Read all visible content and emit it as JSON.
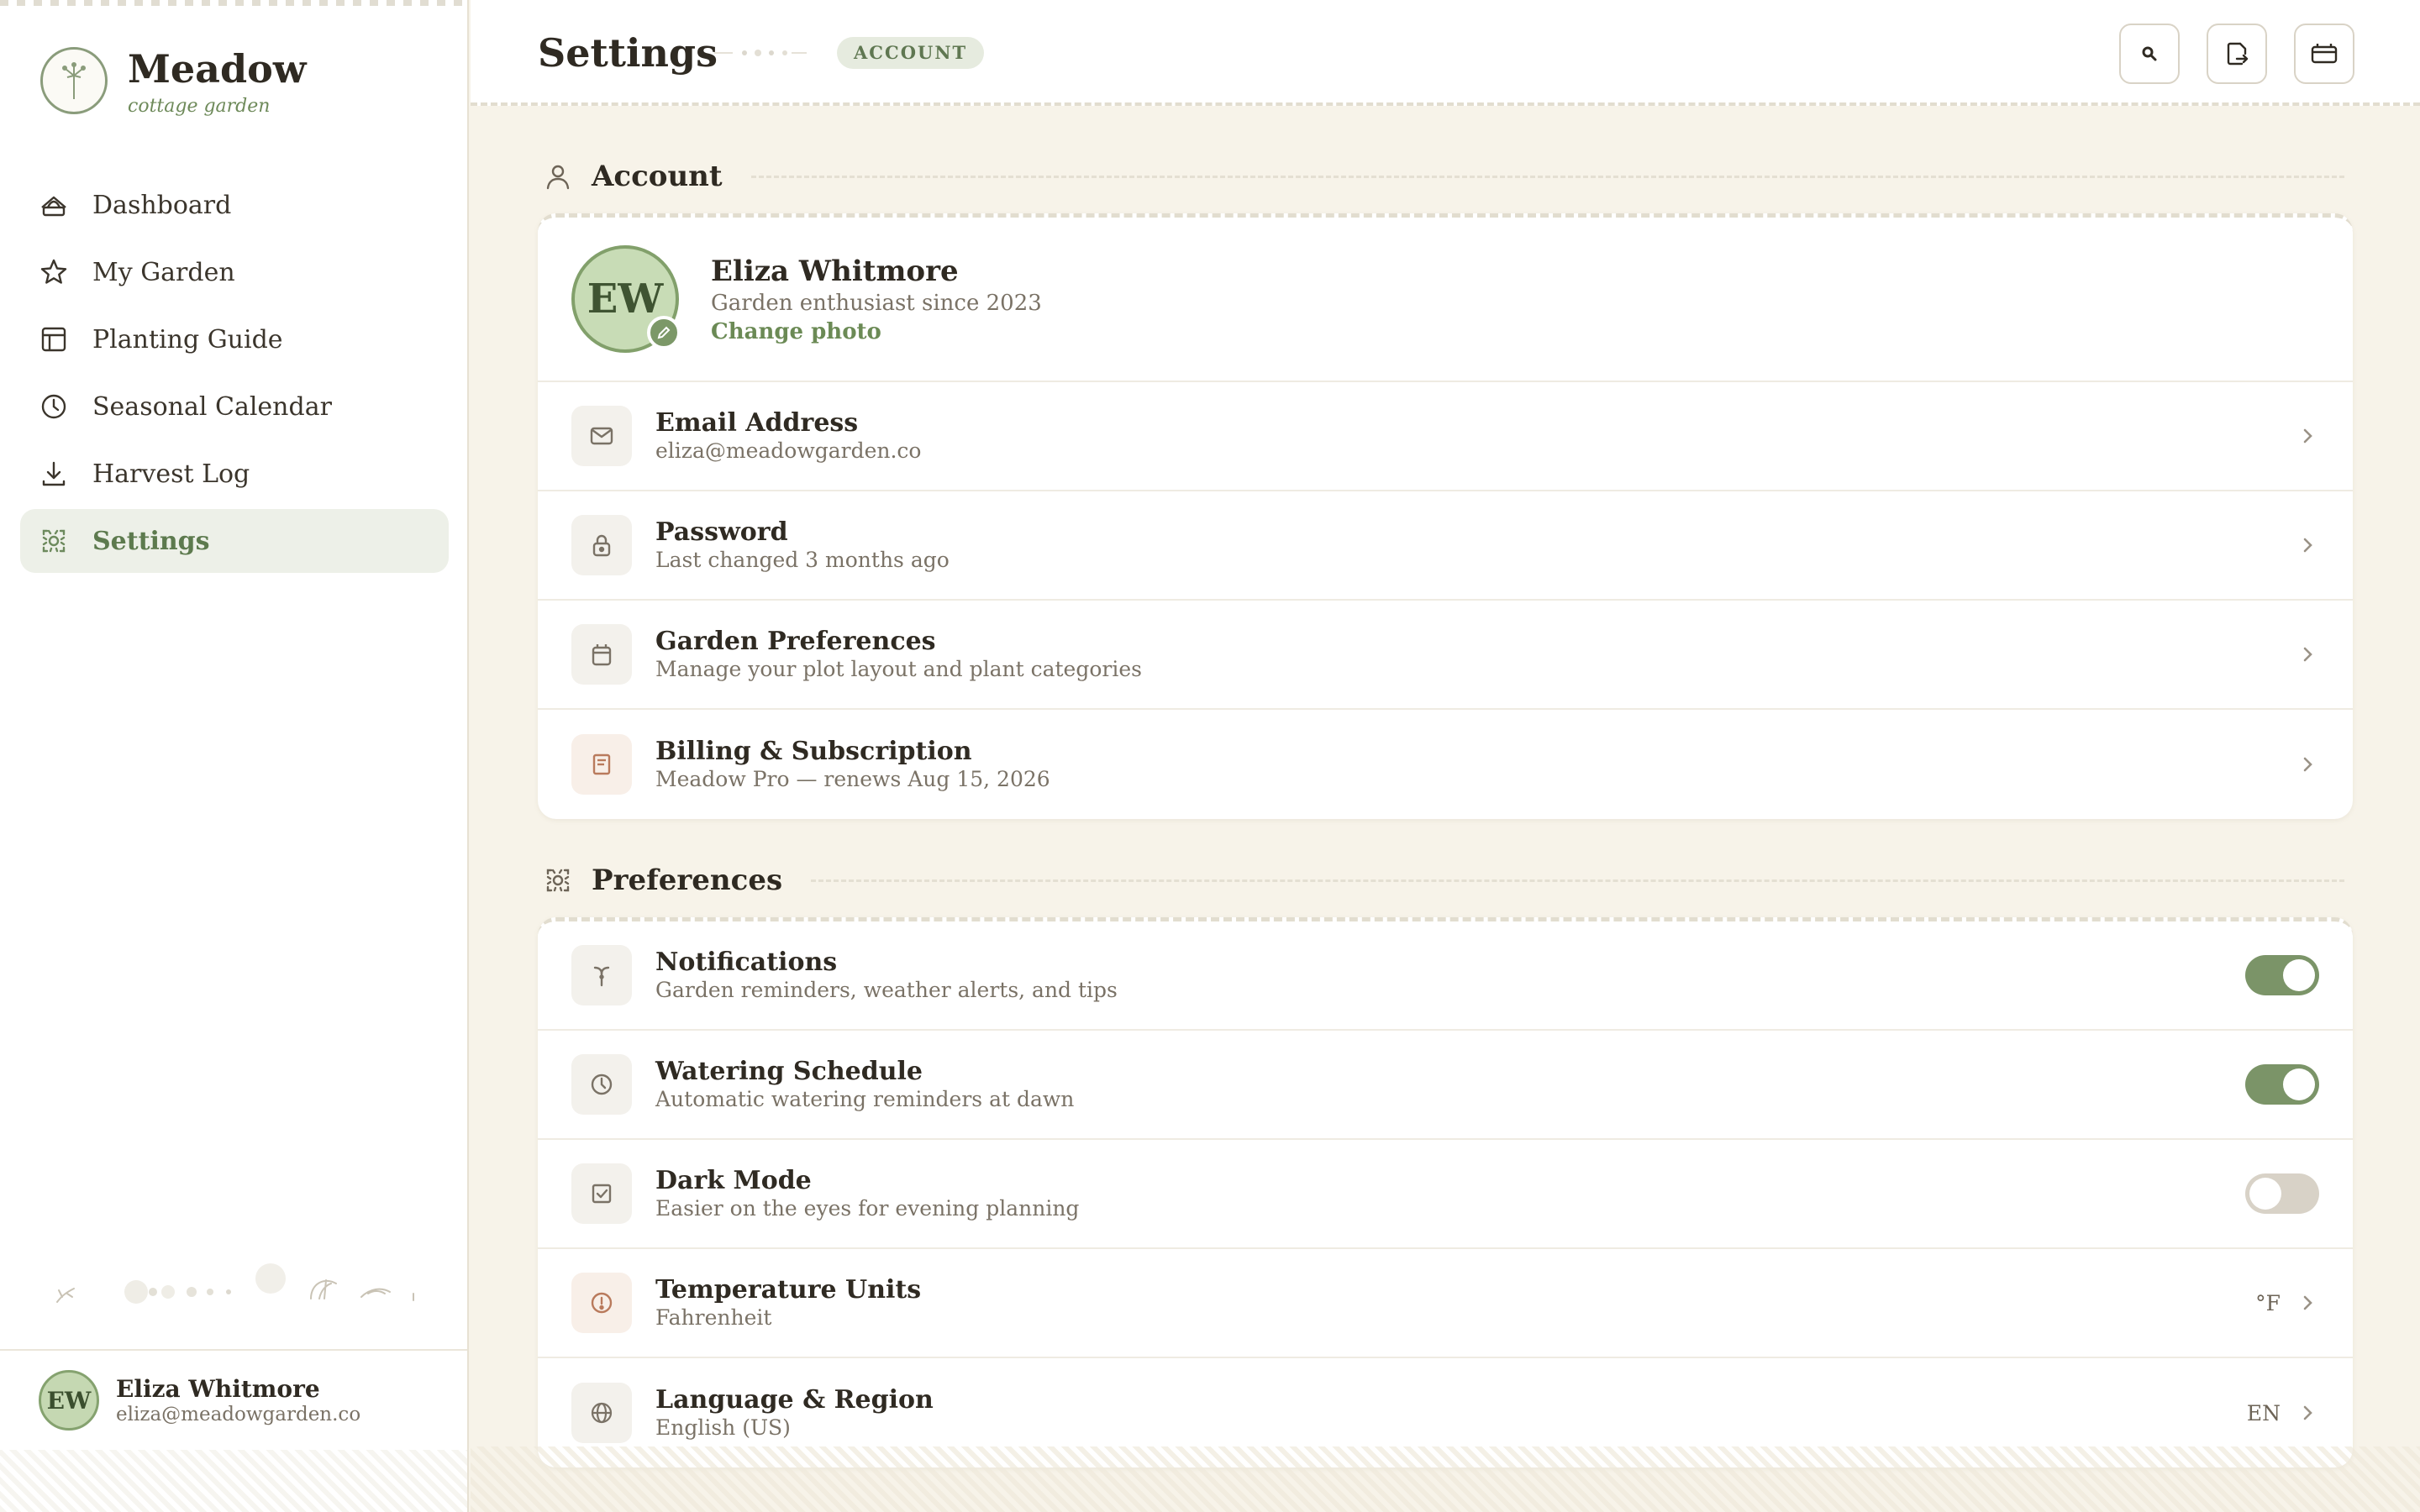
{
  "brand": {
    "name": "Meadow",
    "tagline": "cottage garden"
  },
  "nav": {
    "items": [
      {
        "label": "Dashboard",
        "icon": "garden-bed-icon",
        "active": false
      },
      {
        "label": "My Garden",
        "icon": "star-icon",
        "active": false
      },
      {
        "label": "Planting Guide",
        "icon": "layout-grid-icon",
        "active": false
      },
      {
        "label": "Seasonal Calendar",
        "icon": "clock-icon",
        "active": false
      },
      {
        "label": "Harvest Log",
        "icon": "download-icon",
        "active": false
      },
      {
        "label": "Settings",
        "icon": "settings-gear-icon",
        "active": true
      }
    ]
  },
  "sidebar_user": {
    "initials": "EW",
    "name": "Eliza Whitmore",
    "email": "eliza@meadowgarden.co"
  },
  "header": {
    "title": "Settings",
    "badge": "ACCOUNT",
    "buttons": [
      "search-icon",
      "document-export-icon",
      "storage-box-icon"
    ]
  },
  "account": {
    "section_title": "Account",
    "profile": {
      "initials": "EW",
      "name": "Eliza Whitmore",
      "subtitle": "Garden enthusiast since 2023",
      "link": "Change photo"
    },
    "rows": [
      {
        "title": "Email Address",
        "subtitle": "eliza@meadowgarden.co",
        "icon": "mail-icon"
      },
      {
        "title": "Password",
        "subtitle": "Last changed 3 months ago",
        "icon": "lock-icon"
      },
      {
        "title": "Garden Preferences",
        "subtitle": "Manage your plot layout and plant categories",
        "icon": "calendar-icon"
      },
      {
        "title": "Billing & Subscription",
        "subtitle": "Meadow Pro — renews Aug 15, 2026",
        "icon": "receipt-icon"
      }
    ]
  },
  "preferences": {
    "section_title": "Preferences",
    "rows": [
      {
        "title": "Notifications",
        "subtitle": "Garden reminders, weather alerts, and tips",
        "icon": "sprout-icon",
        "toggle": true
      },
      {
        "title": "Watering Schedule",
        "subtitle": "Automatic watering reminders at dawn",
        "icon": "clock-icon",
        "toggle": true
      },
      {
        "title": "Dark Mode",
        "subtitle": "Easier on the eyes for evening planning",
        "icon": "checkbox-icon",
        "toggle": false
      },
      {
        "title": "Temperature Units",
        "subtitle": "Fahrenheit",
        "icon": "alert-circle-icon",
        "value": "°F"
      },
      {
        "title": "Language & Region",
        "subtitle": "English (US)",
        "icon": "globe-icon",
        "value": "EN"
      }
    ]
  },
  "colors": {
    "accent": "#7b9468",
    "background": "#f7f3e9",
    "active_nav_bg": "#edf0e8",
    "warm_icon": "#b97a5c"
  }
}
